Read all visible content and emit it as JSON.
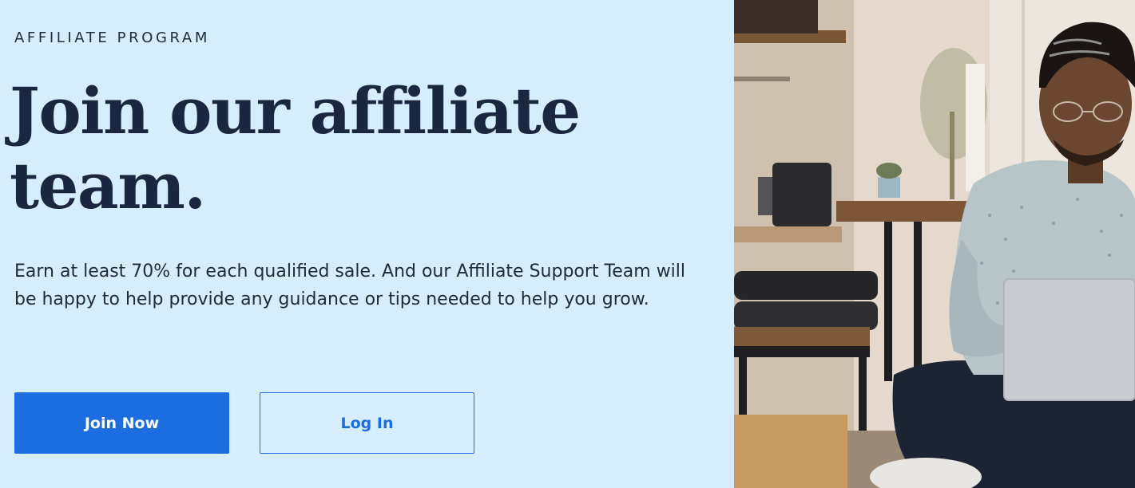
{
  "hero": {
    "eyebrow": "AFFILIATE PROGRAM",
    "headline": "Join our affiliate team.",
    "description": "Earn at least 70% for each qualified sale. And our Affiliate Support Team will be happy to help provide any guidance or tips needed to help you grow.",
    "join_label": "Join Now",
    "login_label": "Log In"
  },
  "colors": {
    "background": "#d6edfd",
    "primary": "#1b6de0",
    "heading": "#1b2740"
  }
}
